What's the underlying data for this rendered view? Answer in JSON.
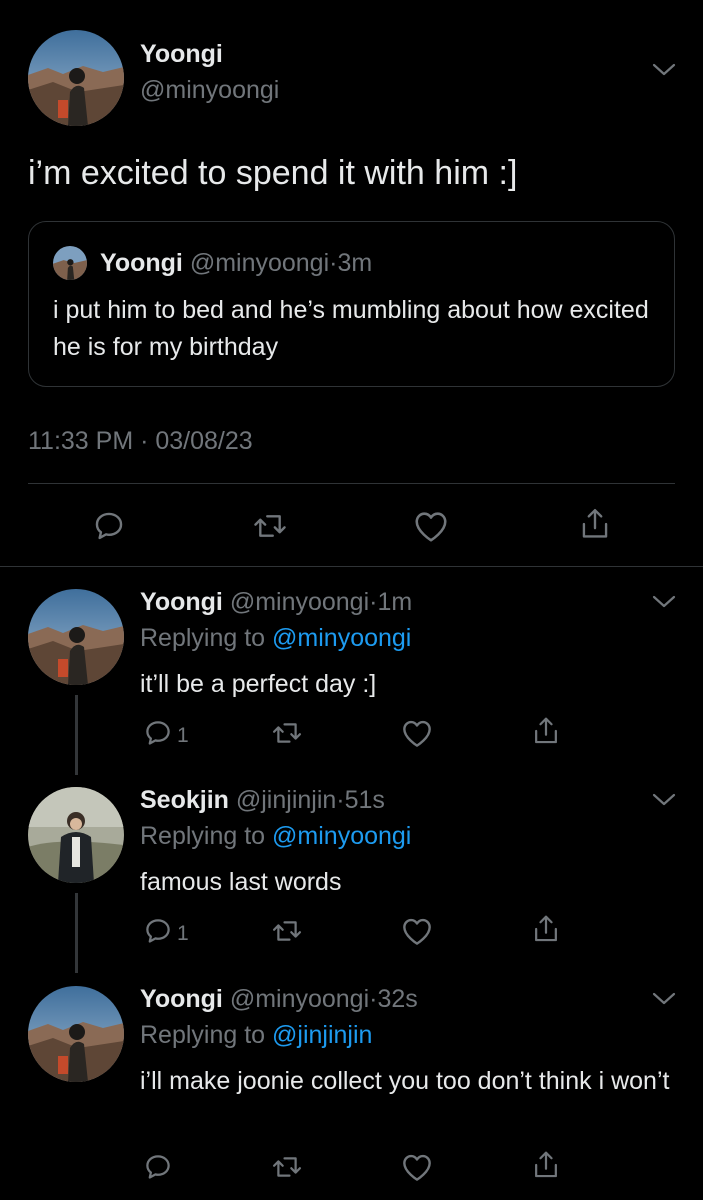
{
  "main_tweet": {
    "display_name": "Yoongi",
    "handle": "@minyoongi",
    "text": "i’m excited to spend it with him :]",
    "quoted": {
      "display_name": "Yoongi",
      "handle": "@minyoongi",
      "separator": "·",
      "time": "3m",
      "text": "i put him to bed and he’s mumbling about how excited he is for my birthday"
    },
    "timestamp": "11:33 PM · 03/08/23"
  },
  "replies": [
    {
      "display_name": "Yoongi",
      "handle": "@minyoongi",
      "separator": "·",
      "time": "1m",
      "replying_prefix": "Replying to ",
      "replying_to": "@minyoongi",
      "text": "it’ll be a perfect day :]",
      "reply_count": "1"
    },
    {
      "display_name": "Seokjin",
      "handle": "@jinjinjin",
      "separator": "·",
      "time": "51s",
      "replying_prefix": "Replying to ",
      "replying_to": "@minyoongi",
      "text": "famous last words",
      "reply_count": "1"
    },
    {
      "display_name": "Yoongi",
      "handle": "@minyoongi",
      "separator": "·",
      "time": "32s",
      "replying_prefix": "Replying to ",
      "replying_to": "@jinjinjin",
      "text": "i’ll make joonie collect you too don’t think i won’t",
      "reply_count": ""
    }
  ],
  "icons": [
    "chevron-down-icon",
    "reply-icon",
    "retweet-icon",
    "like-icon",
    "share-icon"
  ],
  "colors": {
    "background": "#000000",
    "text": "#e7e9ea",
    "muted": "#71767b",
    "link": "#1d9bf0",
    "border": "#2f3336"
  }
}
